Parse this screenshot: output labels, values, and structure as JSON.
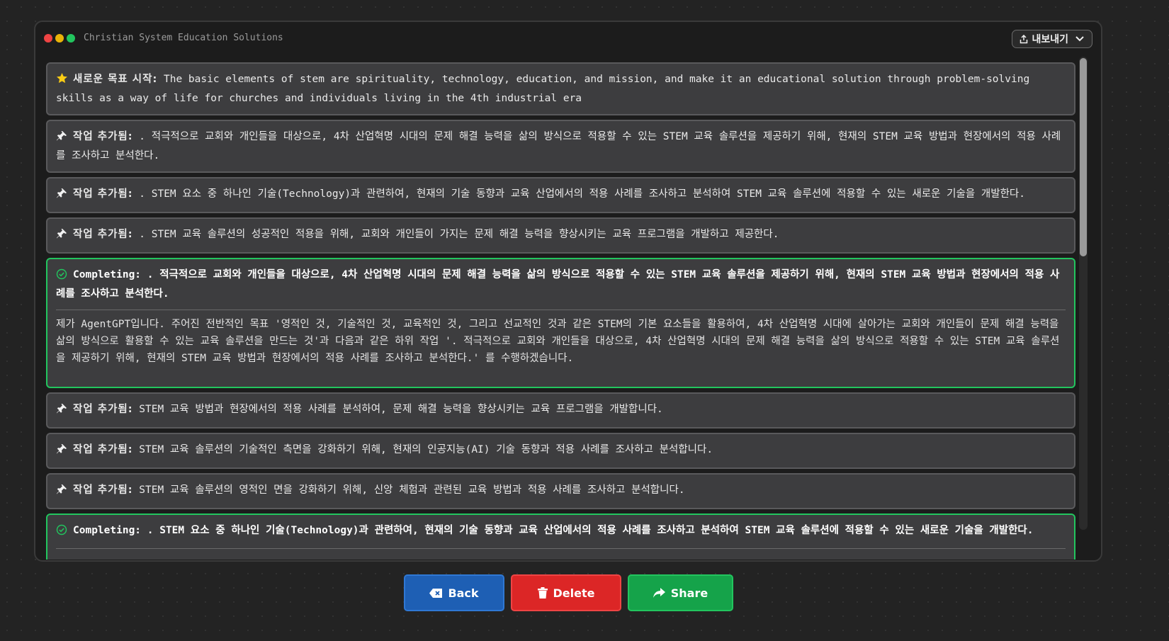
{
  "window": {
    "title": "Christian System Education Solutions"
  },
  "export_button": {
    "label": "내보내기"
  },
  "feed": [
    {
      "kind": "goal",
      "icon": "star-icon",
      "label": "새로운 목표 시작:",
      "text": " The basic elements of stem are spirituality, technology, education, and mission, and make it an educational solution through problem-solving skills as a way of life for churches and individuals living in the 4th industrial era"
    },
    {
      "kind": "task",
      "icon": "pin-icon",
      "label": "작업 추가됨:",
      "text": " . 적극적으로 교회와 개인들을 대상으로, 4차 산업혁명 시대의 문제 해결 능력을 삶의 방식으로 적용할 수 있는 STEM 교육 솔루션을 제공하기 위해, 현재의 STEM 교육 방법과 현장에서의 적용 사례를 조사하고 분석한다."
    },
    {
      "kind": "task",
      "icon": "pin-icon",
      "label": "작업 추가됨:",
      "text": " . STEM 요소 중 하나인 기술(Technology)과 관련하여, 현재의 기술 동향과 교육 산업에서의 적용 사례를 조사하고 분석하여 STEM 교육 솔루션에 적용할 수 있는 새로운 기술을 개발한다."
    },
    {
      "kind": "task",
      "icon": "pin-icon",
      "label": "작업 추가됨:",
      "text": " . STEM 교육 솔루션의 성공적인 적용을 위해, 교회와 개인들이 가지는 문제 해결 능력을 향상시키는 교육 프로그램을 개발하고 제공한다."
    },
    {
      "kind": "completing",
      "icon": "check-circle-icon",
      "label": "Completing:",
      "head": " . 적극적으로 교회와 개인들을 대상으로, 4차 산업혁명 시대의 문제 해결 능력을 삶의 방식으로 적용할 수 있는 STEM 교육 솔루션을 제공하기 위해, 현재의 STEM 교육 방법과 현장에서의 적용 사례를 조사하고 분석한다.",
      "body": "제가 AgentGPT입니다. 주어진 전반적인 목표 '영적인 것, 기술적인 것, 교육적인 것, 그리고 선교적인 것과 같은 STEM의 기본 요소들을 활용하여, 4차 산업혁명 시대에 살아가는 교회와 개인들이 문제 해결 능력을 삶의 방식으로 활용할 수 있는 교육 솔루션을 만드는 것'과 다음과 같은 하위 작업 '. 적극적으로 교회와 개인들을 대상으로, 4차 산업혁명 시대의 문제 해결 능력을 삶의 방식으로 적용할 수 있는 STEM 교육 솔루션을 제공하기 위해, 현재의 STEM 교육 방법과 현장에서의 적용 사례를 조사하고 분석한다.' 를 수행하겠습니다."
    },
    {
      "kind": "task",
      "icon": "pin-icon",
      "label": "작업 추가됨:",
      "text": " STEM 교육 방법과 현장에서의 적용 사례를 분석하여, 문제 해결 능력을 향상시키는 교육 프로그램을 개발합니다."
    },
    {
      "kind": "task",
      "icon": "pin-icon",
      "label": "작업 추가됨:",
      "text": " STEM 교육 솔루션의 기술적인 측면을 강화하기 위해, 현재의 인공지능(AI) 기술 동향과 적용 사례를 조사하고 분석합니다."
    },
    {
      "kind": "task",
      "icon": "pin-icon",
      "label": "작업 추가됨:",
      "text": " STEM 교육 솔루션의 영적인 면을 강화하기 위해, 신앙 체험과 관련된 교육 방법과 적용 사례를 조사하고 분석합니다."
    },
    {
      "kind": "completing",
      "icon": "check-circle-icon",
      "label": "Completing:",
      "head": " . STEM 요소 중 하나인 기술(Technology)과 관련하여, 현재의 기술 동향과 교육 산업에서의 적용 사례를 조사하고 분석하여 STEM 교육 솔루션에 적용할 수 있는 새로운 기술을 개발한다.",
      "body": ""
    }
  ],
  "actions": {
    "back": "Back",
    "delete": "Delete",
    "share": "Share"
  },
  "colors": {
    "accent_green": "#22c55e",
    "back_blue": "#1e5fb4",
    "delete_red": "#dc2626",
    "share_green": "#15a34a",
    "star": "#facc15"
  }
}
